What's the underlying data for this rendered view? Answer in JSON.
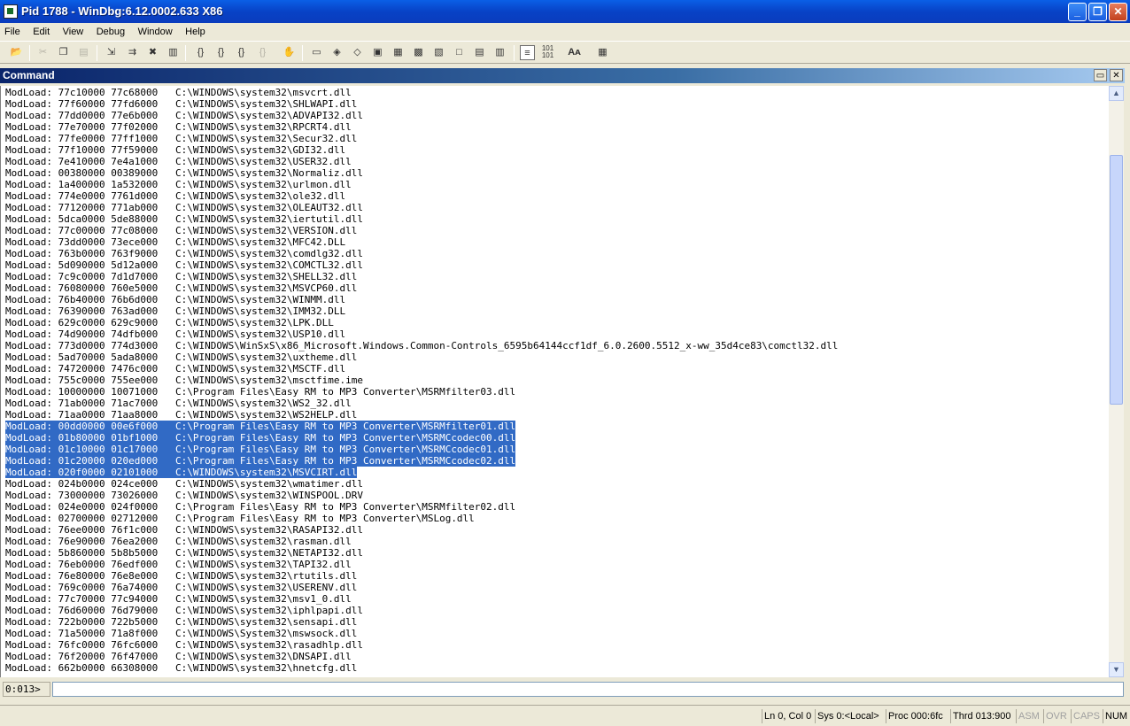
{
  "window": {
    "title": "Pid 1788 - WinDbg:6.12.0002.633 X86",
    "minimize_label": "_",
    "maximize_label": "❐",
    "close_label": "✕"
  },
  "menu": [
    "File",
    "Edit",
    "View",
    "Debug",
    "Window",
    "Help"
  ],
  "toolbar": {
    "icons": [
      "open-icon",
      "cut-icon",
      "copy-icon",
      "paste-icon",
      "step-into-icon",
      "step-over-icon",
      "break-icon",
      "run-to-cursor-icon",
      "step-in-icon",
      "step-out-icon",
      "go-icon",
      "stop-icon",
      "hand-icon",
      "command-window-icon",
      "watch-icon",
      "locals-icon",
      "registers-icon",
      "memory-icon",
      "call-stack-icon",
      "disassembly-icon",
      "scratch-pad-icon",
      "processes-icon",
      "threads-icon",
      "source-mode-icon",
      "hex-icon",
      "font-icon",
      "options-icon"
    ]
  },
  "command_window": {
    "title": "Command",
    "dock_label": "▭",
    "close_label": "✕"
  },
  "output_lines": [
    {
      "text": "ModLoad: 77c10000 77c68000   C:\\WINDOWS\\system32\\msvcrt.dll",
      "selected": false
    },
    {
      "text": "ModLoad: 77f60000 77fd6000   C:\\WINDOWS\\system32\\SHLWAPI.dll",
      "selected": false
    },
    {
      "text": "ModLoad: 77dd0000 77e6b000   C:\\WINDOWS\\system32\\ADVAPI32.dll",
      "selected": false
    },
    {
      "text": "ModLoad: 77e70000 77f02000   C:\\WINDOWS\\system32\\RPCRT4.dll",
      "selected": false
    },
    {
      "text": "ModLoad: 77fe0000 77ff1000   C:\\WINDOWS\\system32\\Secur32.dll",
      "selected": false
    },
    {
      "text": "ModLoad: 77f10000 77f59000   C:\\WINDOWS\\system32\\GDI32.dll",
      "selected": false
    },
    {
      "text": "ModLoad: 7e410000 7e4a1000   C:\\WINDOWS\\system32\\USER32.dll",
      "selected": false
    },
    {
      "text": "ModLoad: 00380000 00389000   C:\\WINDOWS\\system32\\Normaliz.dll",
      "selected": false
    },
    {
      "text": "ModLoad: 1a400000 1a532000   C:\\WINDOWS\\system32\\urlmon.dll",
      "selected": false
    },
    {
      "text": "ModLoad: 774e0000 7761d000   C:\\WINDOWS\\system32\\ole32.dll",
      "selected": false
    },
    {
      "text": "ModLoad: 77120000 771ab000   C:\\WINDOWS\\system32\\OLEAUT32.dll",
      "selected": false
    },
    {
      "text": "ModLoad: 5dca0000 5de88000   C:\\WINDOWS\\system32\\iertutil.dll",
      "selected": false
    },
    {
      "text": "ModLoad: 77c00000 77c08000   C:\\WINDOWS\\system32\\VERSION.dll",
      "selected": false
    },
    {
      "text": "ModLoad: 73dd0000 73ece000   C:\\WINDOWS\\system32\\MFC42.DLL",
      "selected": false
    },
    {
      "text": "ModLoad: 763b0000 763f9000   C:\\WINDOWS\\system32\\comdlg32.dll",
      "selected": false
    },
    {
      "text": "ModLoad: 5d090000 5d12a000   C:\\WINDOWS\\system32\\COMCTL32.dll",
      "selected": false
    },
    {
      "text": "ModLoad: 7c9c0000 7d1d7000   C:\\WINDOWS\\system32\\SHELL32.dll",
      "selected": false
    },
    {
      "text": "ModLoad: 76080000 760e5000   C:\\WINDOWS\\system32\\MSVCP60.dll",
      "selected": false
    },
    {
      "text": "ModLoad: 76b40000 76b6d000   C:\\WINDOWS\\system32\\WINMM.dll",
      "selected": false
    },
    {
      "text": "ModLoad: 76390000 763ad000   C:\\WINDOWS\\system32\\IMM32.DLL",
      "selected": false
    },
    {
      "text": "ModLoad: 629c0000 629c9000   C:\\WINDOWS\\system32\\LPK.DLL",
      "selected": false
    },
    {
      "text": "ModLoad: 74d90000 74dfb000   C:\\WINDOWS\\system32\\USP10.dll",
      "selected": false
    },
    {
      "text": "ModLoad: 773d0000 774d3000   C:\\WINDOWS\\WinSxS\\x86_Microsoft.Windows.Common-Controls_6595b64144ccf1df_6.0.2600.5512_x-ww_35d4ce83\\comctl32.dll",
      "selected": false
    },
    {
      "text": "ModLoad: 5ad70000 5ada8000   C:\\WINDOWS\\system32\\uxtheme.dll",
      "selected": false
    },
    {
      "text": "ModLoad: 74720000 7476c000   C:\\WINDOWS\\system32\\MSCTF.dll",
      "selected": false
    },
    {
      "text": "ModLoad: 755c0000 755ee000   C:\\WINDOWS\\system32\\msctfime.ime",
      "selected": false
    },
    {
      "text": "ModLoad: 10000000 10071000   C:\\Program Files\\Easy RM to MP3 Converter\\MSRMfilter03.dll",
      "selected": false
    },
    {
      "text": "ModLoad: 71ab0000 71ac7000   C:\\WINDOWS\\system32\\WS2_32.dll",
      "selected": false
    },
    {
      "text": "ModLoad: 71aa0000 71aa8000   C:\\WINDOWS\\system32\\WS2HELP.dll",
      "selected": false
    },
    {
      "text": "ModLoad: 00dd0000 00e6f000   C:\\Program Files\\Easy RM to MP3 Converter\\MSRMfilter01.dll",
      "selected": true
    },
    {
      "text": "ModLoad: 01b80000 01bf1000   C:\\Program Files\\Easy RM to MP3 Converter\\MSRMCcodec00.dll",
      "selected": true
    },
    {
      "text": "ModLoad: 01c10000 01c17000   C:\\Program Files\\Easy RM to MP3 Converter\\MSRMCcodec01.dll",
      "selected": true
    },
    {
      "text": "ModLoad: 01c20000 020ed000   C:\\Program Files\\Easy RM to MP3 Converter\\MSRMCcodec02.dll",
      "selected": true
    },
    {
      "text": "ModLoad: 020f0000 02101000   C:\\WINDOWS\\system32\\MSVCIRT.dll",
      "selected": true
    },
    {
      "text": "ModLoad: 024b0000 024ce000   C:\\WINDOWS\\system32\\wmatimer.dll",
      "selected": false
    },
    {
      "text": "ModLoad: 73000000 73026000   C:\\WINDOWS\\system32\\WINSPOOL.DRV",
      "selected": false
    },
    {
      "text": "ModLoad: 024e0000 024f0000   C:\\Program Files\\Easy RM to MP3 Converter\\MSRMfilter02.dll",
      "selected": false
    },
    {
      "text": "ModLoad: 02700000 02712000   C:\\Program Files\\Easy RM to MP3 Converter\\MSLog.dll",
      "selected": false
    },
    {
      "text": "ModLoad: 76ee0000 76f1c000   C:\\WINDOWS\\system32\\RASAPI32.dll",
      "selected": false
    },
    {
      "text": "ModLoad: 76e90000 76ea2000   C:\\WINDOWS\\system32\\rasman.dll",
      "selected": false
    },
    {
      "text": "ModLoad: 5b860000 5b8b5000   C:\\WINDOWS\\system32\\NETAPI32.dll",
      "selected": false
    },
    {
      "text": "ModLoad: 76eb0000 76edf000   C:\\WINDOWS\\system32\\TAPI32.dll",
      "selected": false
    },
    {
      "text": "ModLoad: 76e80000 76e8e000   C:\\WINDOWS\\system32\\rtutils.dll",
      "selected": false
    },
    {
      "text": "ModLoad: 769c0000 76a74000   C:\\WINDOWS\\system32\\USERENV.dll",
      "selected": false
    },
    {
      "text": "ModLoad: 77c70000 77c94000   C:\\WINDOWS\\system32\\msv1_0.dll",
      "selected": false
    },
    {
      "text": "ModLoad: 76d60000 76d79000   C:\\WINDOWS\\system32\\iphlpapi.dll",
      "selected": false
    },
    {
      "text": "ModLoad: 722b0000 722b5000   C:\\WINDOWS\\system32\\sensapi.dll",
      "selected": false
    },
    {
      "text": "ModLoad: 71a50000 71a8f000   C:\\WINDOWS\\System32\\mswsock.dll",
      "selected": false
    },
    {
      "text": "ModLoad: 76fc0000 76fc6000   C:\\WINDOWS\\system32\\rasadhlp.dll",
      "selected": false
    },
    {
      "text": "ModLoad: 76f20000 76f47000   C:\\WINDOWS\\system32\\DNSAPI.dll",
      "selected": false
    },
    {
      "text": "ModLoad: 662b0000 66308000   C:\\WINDOWS\\system32\\hnetcfg.dll",
      "selected": false
    }
  ],
  "prompt": {
    "label": "0:013>",
    "value": ""
  },
  "statusbar": {
    "position": "Ln 0, Col 0",
    "system": "Sys 0:<Local>",
    "process": "Proc 000:6fc",
    "thread": "Thrd 013:900",
    "asm": "ASM",
    "ovr": "OVR",
    "caps": "CAPS",
    "num": "NUM"
  }
}
